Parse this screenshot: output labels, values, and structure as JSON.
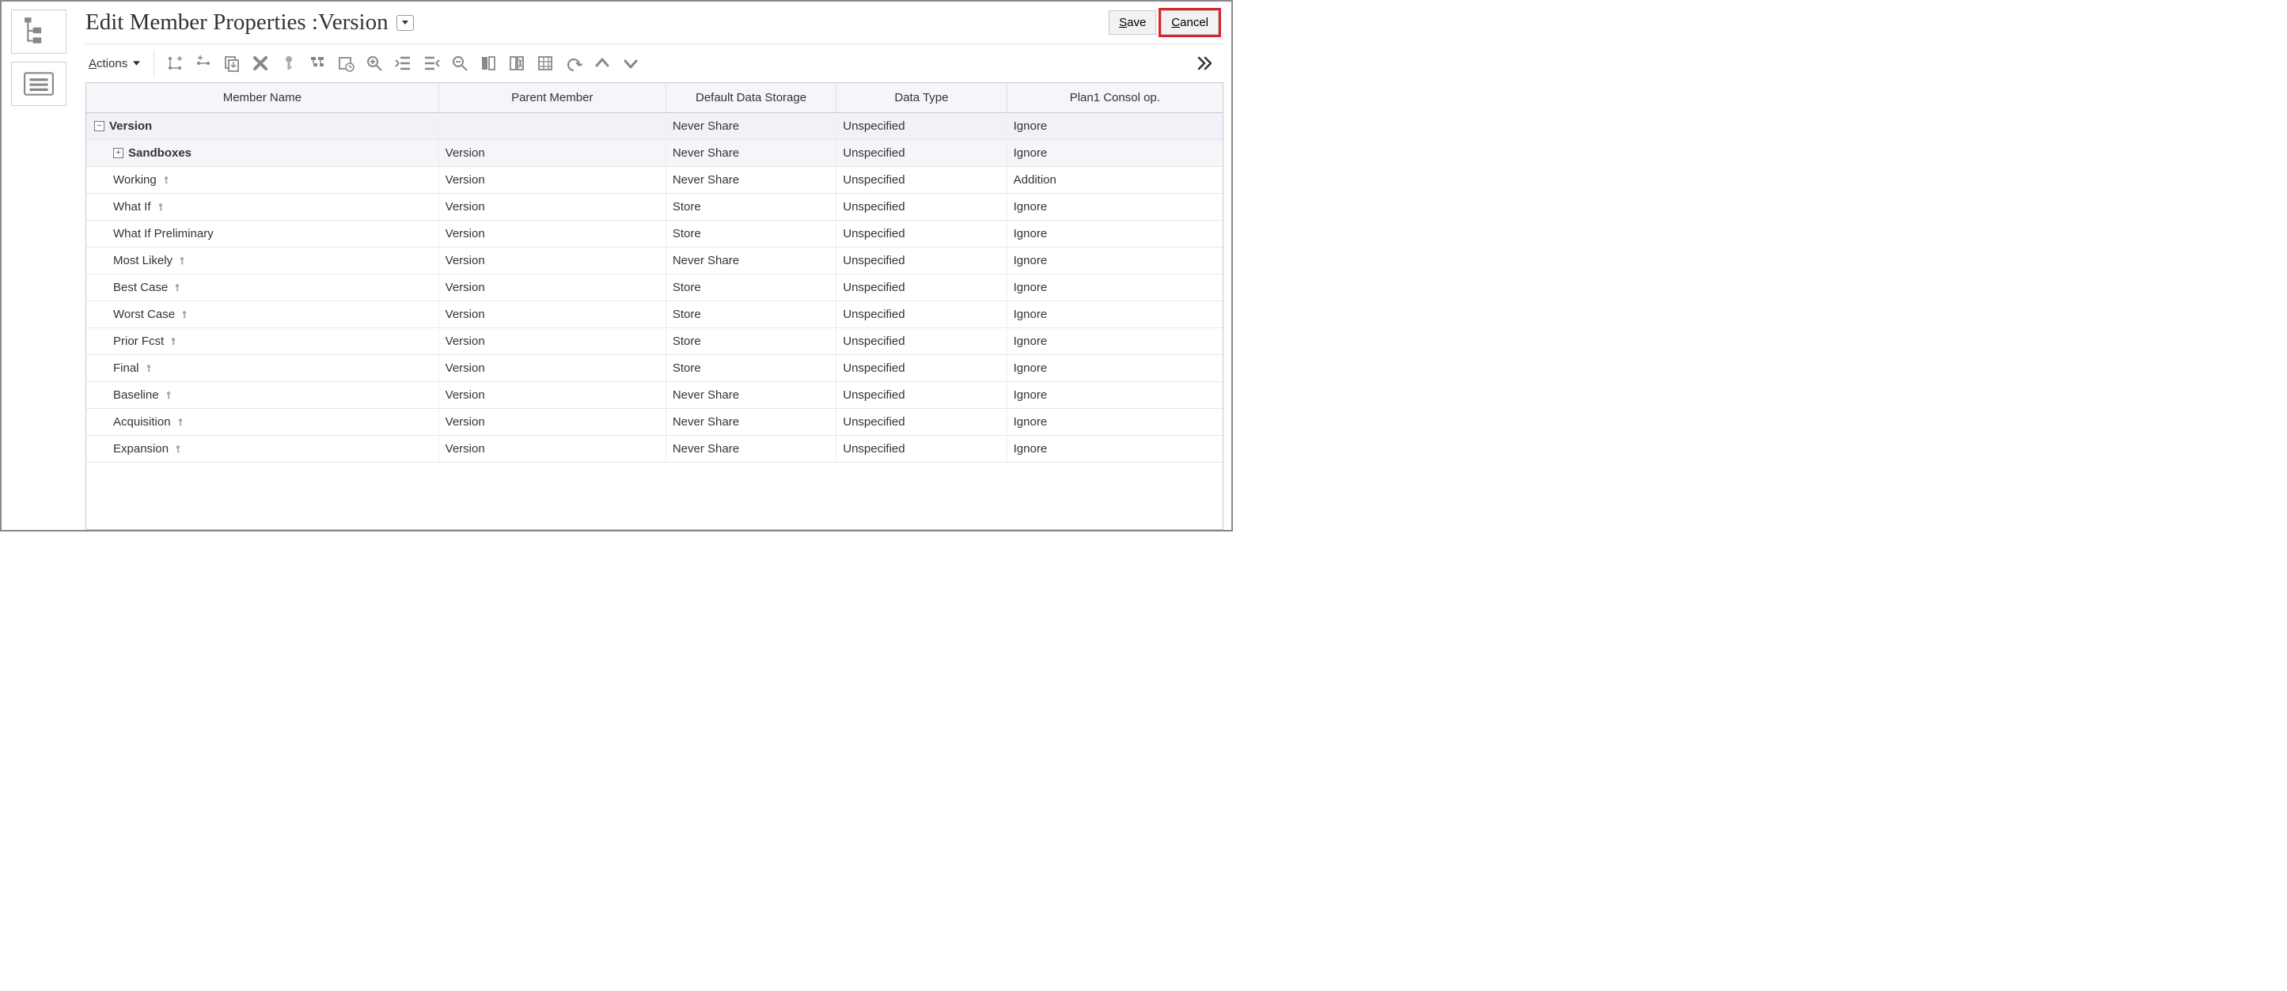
{
  "header": {
    "title": "Edit Member Properties :Version",
    "save_label": "Save",
    "cancel_label": "Cancel",
    "save_underline": "S",
    "cancel_underline": "C"
  },
  "toolbar": {
    "actions_label": "Actions",
    "actions_underline": "A",
    "icons": [
      "add-child-icon",
      "add-sibling-icon",
      "duplicate-icon",
      "delete-icon",
      "key-icon",
      "outline-icon",
      "history-icon",
      "zoom-in-icon",
      "outdent-icon",
      "indent-icon",
      "zoom-out-icon",
      "freeze-col-icon",
      "unfreeze-col-icon",
      "grid-icon",
      "undo-icon",
      "move-up-icon",
      "move-down-icon"
    ],
    "overflow_icon": "overflow-icon"
  },
  "grid": {
    "columns": [
      "Member Name",
      "Parent Member",
      "Default Data Storage",
      "Data Type",
      "Plan1 Consol op."
    ],
    "rows": [
      {
        "name": "Version",
        "parent": "",
        "storage": "Never Share",
        "dtype": "Unspecified",
        "consol": "Ignore",
        "level": 0,
        "expandable": true,
        "expanded": true,
        "key": false
      },
      {
        "name": "Sandboxes",
        "parent": "Version",
        "storage": "Never Share",
        "dtype": "Unspecified",
        "consol": "Ignore",
        "level": 1,
        "expandable": true,
        "expanded": false,
        "key": false
      },
      {
        "name": "Working",
        "parent": "Version",
        "storage": "Never Share",
        "dtype": "Unspecified",
        "consol": "Addition",
        "level": 2,
        "expandable": false,
        "expanded": false,
        "key": true
      },
      {
        "name": "What If",
        "parent": "Version",
        "storage": "Store",
        "dtype": "Unspecified",
        "consol": "Ignore",
        "level": 2,
        "expandable": false,
        "expanded": false,
        "key": true
      },
      {
        "name": "What If Preliminary",
        "parent": "Version",
        "storage": "Store",
        "dtype": "Unspecified",
        "consol": "Ignore",
        "level": 2,
        "expandable": false,
        "expanded": false,
        "key": false
      },
      {
        "name": "Most Likely",
        "parent": "Version",
        "storage": "Never Share",
        "dtype": "Unspecified",
        "consol": "Ignore",
        "level": 2,
        "expandable": false,
        "expanded": false,
        "key": true
      },
      {
        "name": "Best Case",
        "parent": "Version",
        "storage": "Store",
        "dtype": "Unspecified",
        "consol": "Ignore",
        "level": 2,
        "expandable": false,
        "expanded": false,
        "key": true
      },
      {
        "name": "Worst Case",
        "parent": "Version",
        "storage": "Store",
        "dtype": "Unspecified",
        "consol": "Ignore",
        "level": 2,
        "expandable": false,
        "expanded": false,
        "key": true
      },
      {
        "name": "Prior Fcst",
        "parent": "Version",
        "storage": "Store",
        "dtype": "Unspecified",
        "consol": "Ignore",
        "level": 2,
        "expandable": false,
        "expanded": false,
        "key": true
      },
      {
        "name": "Final",
        "parent": "Version",
        "storage": "Store",
        "dtype": "Unspecified",
        "consol": "Ignore",
        "level": 2,
        "expandable": false,
        "expanded": false,
        "key": true
      },
      {
        "name": "Baseline",
        "parent": "Version",
        "storage": "Never Share",
        "dtype": "Unspecified",
        "consol": "Ignore",
        "level": 2,
        "expandable": false,
        "expanded": false,
        "key": true
      },
      {
        "name": "Acquisition",
        "parent": "Version",
        "storage": "Never Share",
        "dtype": "Unspecified",
        "consol": "Ignore",
        "level": 2,
        "expandable": false,
        "expanded": false,
        "key": true
      },
      {
        "name": "Expansion",
        "parent": "Version",
        "storage": "Never Share",
        "dtype": "Unspecified",
        "consol": "Ignore",
        "level": 2,
        "expandable": false,
        "expanded": false,
        "key": true
      }
    ]
  }
}
